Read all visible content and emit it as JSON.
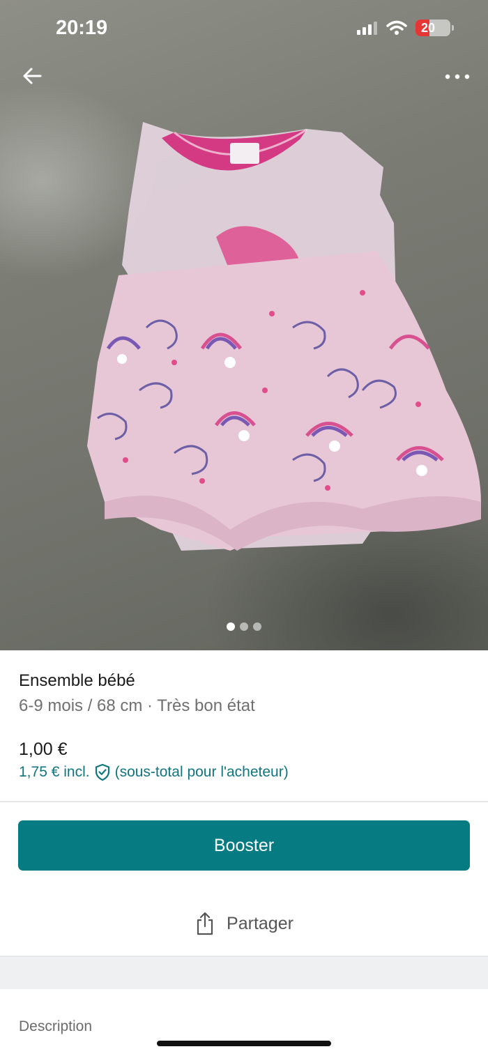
{
  "status_bar": {
    "time": "20:19",
    "battery": "20"
  },
  "photo": {
    "pages": 3,
    "current_page": 1
  },
  "product": {
    "title": "Ensemble bébé",
    "subtitle": "6-9 mois / 68 cm · Très bon état",
    "price": "1,00 €",
    "price_incl": "1,75 € incl.",
    "price_incl_note": "(sous-total pour l'acheteur)"
  },
  "actions": {
    "booster_label": "Booster",
    "share_label": "Partager"
  },
  "description": {
    "label": "Description"
  },
  "colors": {
    "accent": "#077b82",
    "link": "#0f7680",
    "battery_low": "#e53535"
  },
  "icons": [
    "back-arrow-icon",
    "more-options-icon",
    "shield-check-icon",
    "share-icon",
    "signal-icon",
    "wifi-icon",
    "battery-icon"
  ]
}
